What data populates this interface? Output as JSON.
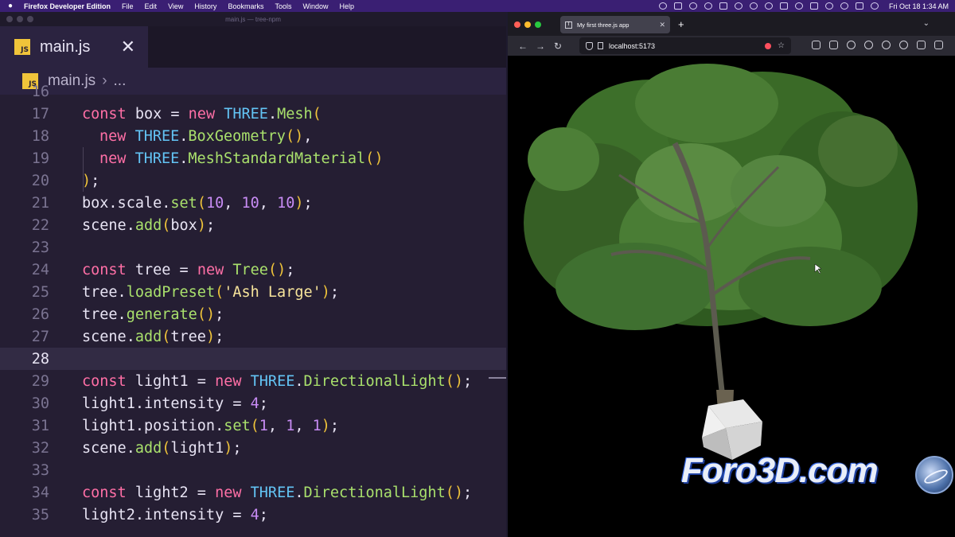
{
  "menubar": {
    "items": [
      "Firefox Developer Edition",
      "File",
      "Edit",
      "View",
      "History",
      "Bookmarks",
      "Tools",
      "Window",
      "Help"
    ],
    "clock": "Fri Oct 18  1:34 AM"
  },
  "editor": {
    "window_title": "main.js — tree-npm",
    "tab": {
      "badge": "JS",
      "label": "main.js",
      "close": "✕"
    },
    "breadcrumb": {
      "badge": "JS",
      "file": "main.js",
      "sep": "›",
      "more": "..."
    },
    "partial_line": "16",
    "lines": [
      {
        "n": "17",
        "text": "const box = new THREE.Mesh("
      },
      {
        "n": "18",
        "text": "new THREE.BoxGeometry(),"
      },
      {
        "n": "19",
        "text": "new THREE.MeshStandardMaterial()"
      },
      {
        "n": "20",
        "text": ");"
      },
      {
        "n": "21",
        "text": "box.scale.set(10, 10, 10);"
      },
      {
        "n": "22",
        "text": "scene.add(box);"
      },
      {
        "n": "23",
        "text": ""
      },
      {
        "n": "24",
        "text": "const tree = new Tree();"
      },
      {
        "n": "25",
        "text": "tree.loadPreset('Ash Large');"
      },
      {
        "n": "26",
        "text": "tree.generate();"
      },
      {
        "n": "27",
        "text": "scene.add(tree);"
      },
      {
        "n": "28",
        "text": ""
      },
      {
        "n": "29",
        "text": "const light1 = new THREE.DirectionalLight();"
      },
      {
        "n": "30",
        "text": "light1.intensity = 4;"
      },
      {
        "n": "31",
        "text": "light1.position.set(1, 1, 1);"
      },
      {
        "n": "32",
        "text": "scene.add(light1);"
      },
      {
        "n": "33",
        "text": ""
      },
      {
        "n": "34",
        "text": "const light2 = new THREE.DirectionalLight();"
      },
      {
        "n": "35",
        "text": "light2.intensity = 4;"
      }
    ],
    "colors": {
      "keyword": "#ff6fa6",
      "class": "#63c4f5",
      "function": "#a9e06c",
      "paren": "#f0c43a",
      "number": "#c88cf5",
      "string": "#f7e49b"
    }
  },
  "browser": {
    "tab_title": "My first three.js app",
    "tab_close": "✕",
    "new_tab": "+",
    "url": "localhost:5173",
    "nav": {
      "back": "←",
      "forward": "→",
      "reload": "↻"
    }
  },
  "watermark": "Foro3D.com"
}
